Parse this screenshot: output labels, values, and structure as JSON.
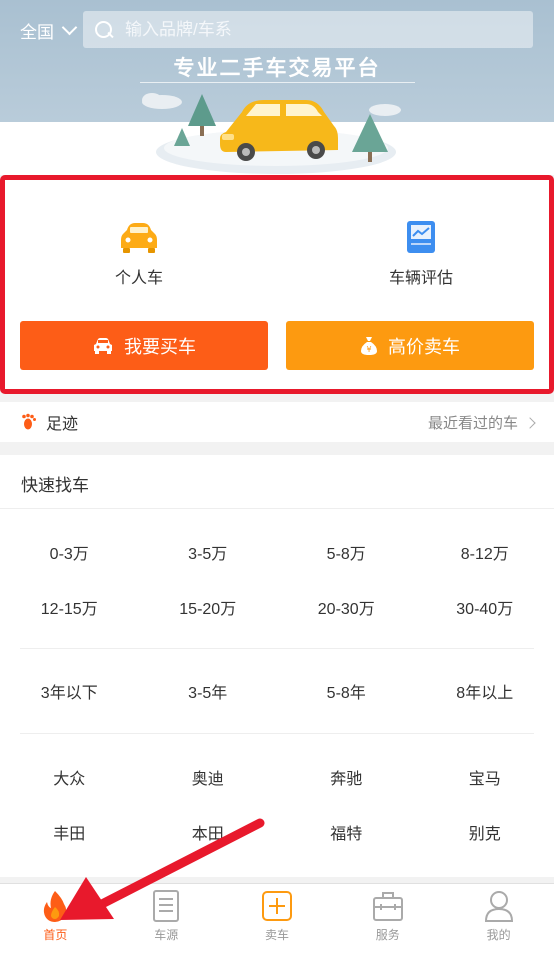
{
  "header": {
    "city": "全国",
    "search_placeholder": "输入品牌/车系",
    "slogan": "专业二手车交易平台"
  },
  "entries": {
    "personal_car": "个人车",
    "vehicle_assessment": "车辆评估"
  },
  "actions": {
    "buy_label": "我要买车",
    "sell_label": "高价卖车"
  },
  "footprint": {
    "label": "足迹",
    "recent_label": "最近看过的车"
  },
  "quick_find": {
    "title": "快速找车",
    "price_ranges": [
      "0-3万",
      "3-5万",
      "5-8万",
      "8-12万",
      "12-15万",
      "15-20万",
      "20-30万",
      "30-40万"
    ],
    "ages": [
      "3年以下",
      "3-5年",
      "5-8年",
      "8年以上"
    ],
    "brands": [
      "大众",
      "奥迪",
      "奔驰",
      "宝马",
      "丰田",
      "本田",
      "福特",
      "别克"
    ]
  },
  "tabbar": {
    "items": [
      {
        "label": "首页",
        "icon": "flame-icon",
        "active": true
      },
      {
        "label": "车源",
        "icon": "document-icon",
        "active": false
      },
      {
        "label": "卖车",
        "icon": "plus-box-icon",
        "active": false
      },
      {
        "label": "服务",
        "icon": "briefcase-icon",
        "active": false
      },
      {
        "label": "我的",
        "icon": "user-icon",
        "active": false
      }
    ]
  },
  "colors": {
    "accent_orange_red": "#fd5d17",
    "accent_orange": "#fd9a10",
    "highlight_red": "#e8192c",
    "hero_blue": "#a9c0d1"
  }
}
